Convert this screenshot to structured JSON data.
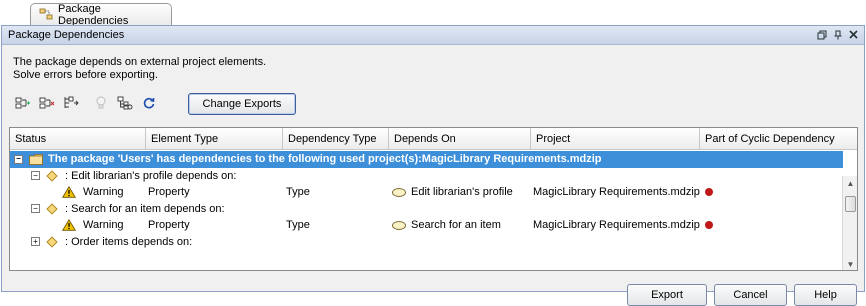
{
  "tab": {
    "label": "Package Dependencies",
    "icon": "package-dependencies-icon"
  },
  "window": {
    "title": "Package Dependencies",
    "controls": [
      "restore-icon",
      "pin-icon",
      "close-icon"
    ]
  },
  "message": {
    "line1": "The package depends on external project elements.",
    "line2": "Solve errors before exporting."
  },
  "toolbar": {
    "icons": [
      "expand-all-icon",
      "collapse-all-icon",
      "expand-selected-icon",
      "hint-icon",
      "show-in-tree-icon",
      "refresh-icon"
    ],
    "change_exports_label": "Change Exports"
  },
  "table": {
    "columns": [
      "Status",
      "Element Type",
      "Dependency Type",
      "Depends On",
      "Project",
      "Part of Cyclic Dependency"
    ],
    "group": {
      "text": "The package 'Users' has dependencies to the following used project(s):MagicLibrary Requirements.mdzip",
      "expanded": true
    },
    "items": [
      {
        "label": ": Edit librarian's  profile depends on:",
        "expanded": true,
        "status": "Warning",
        "element_type": "Property",
        "dependency_type": "Type",
        "depends_on": "Edit librarian's  profile",
        "project": "MagicLibrary Requirements.mdzip",
        "cyclic": true
      },
      {
        "label": ": Search for an item depends on:",
        "expanded": true,
        "status": "Warning",
        "element_type": "Property",
        "dependency_type": "Type",
        "depends_on": "Search for an item",
        "project": "MagicLibrary Requirements.mdzip",
        "cyclic": true
      },
      {
        "label": ": Order items depends on:",
        "expanded": false
      }
    ]
  },
  "buttons": {
    "export": "Export",
    "cancel": "Cancel",
    "help": "Help"
  },
  "colors": {
    "selection": "#3c8fd8",
    "cyclic_dot": "#c01818",
    "warning": "#f2c200",
    "focus_border": "#3c5f9c"
  }
}
